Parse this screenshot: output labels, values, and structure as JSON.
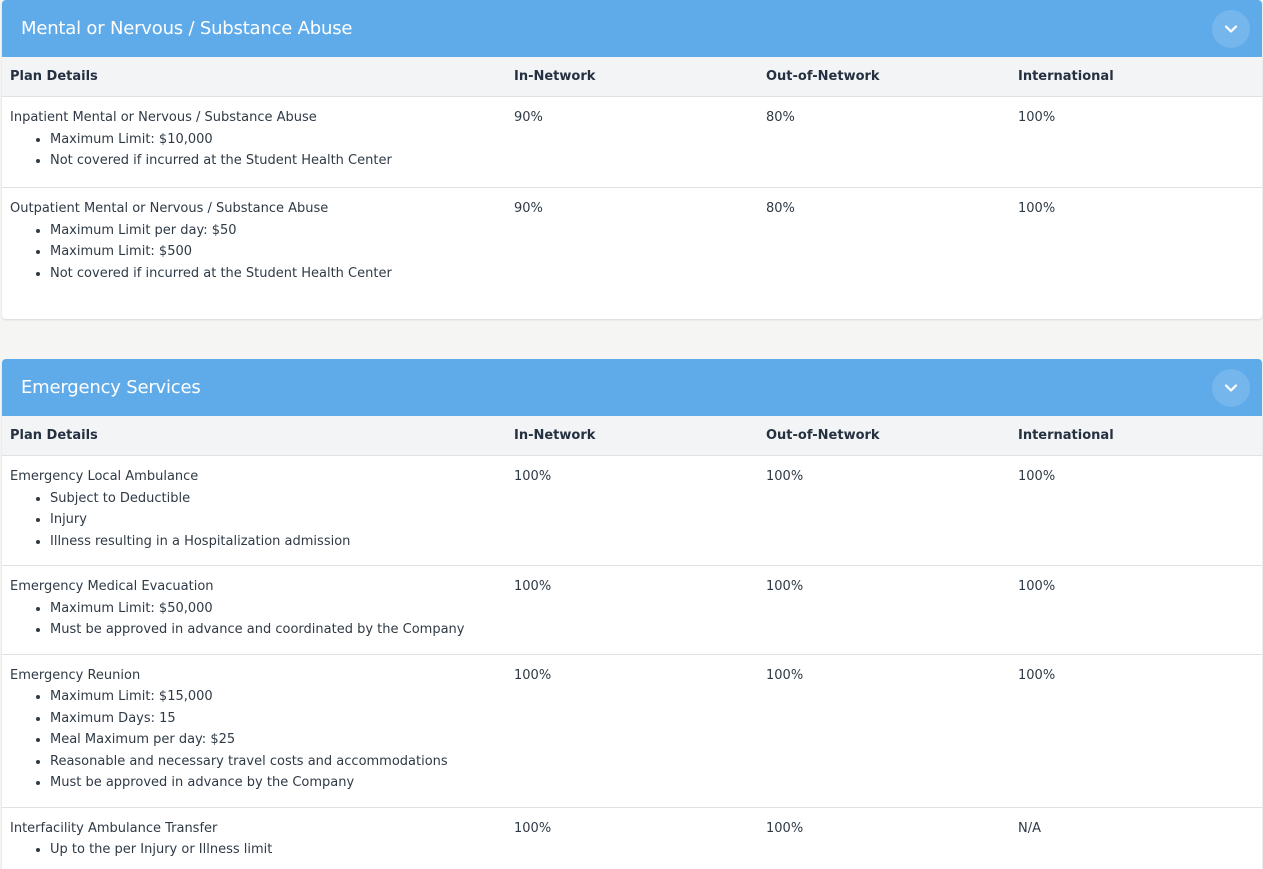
{
  "sections": [
    {
      "title": "Mental or Nervous / Substance Abuse",
      "headers": {
        "plan": "Plan Details",
        "in_network": "In-Network",
        "out_network": "Out-of-Network",
        "international": "International"
      },
      "rows": [
        {
          "name": "Inpatient Mental or Nervous / Substance Abuse",
          "details": [
            "Maximum Limit: $10,000",
            "Not covered if incurred at the Student Health Center"
          ],
          "in_network": "90%",
          "out_network": "80%",
          "international": "100%"
        },
        {
          "name": "Outpatient Mental or Nervous / Substance Abuse",
          "details": [
            "Maximum Limit per day: $50",
            "Maximum Limit: $500",
            "Not covered if incurred at the Student Health Center"
          ],
          "in_network": "90%",
          "out_network": "80%",
          "international": "100%"
        }
      ]
    },
    {
      "title": "Emergency Services",
      "headers": {
        "plan": "Plan Details",
        "in_network": "In-Network",
        "out_network": "Out-of-Network",
        "international": "International"
      },
      "rows": [
        {
          "name": "Emergency Local Ambulance",
          "details": [
            "Subject to Deductible",
            "Injury",
            "Illness resulting in a Hospitalization admission"
          ],
          "in_network": "100%",
          "out_network": "100%",
          "international": "100%"
        },
        {
          "name": "Emergency Medical Evacuation",
          "details": [
            "Maximum Limit: $50,000",
            "Must be approved in advance and coordinated by the Company"
          ],
          "in_network": "100%",
          "out_network": "100%",
          "international": "100%"
        },
        {
          "name": "Emergency Reunion",
          "details": [
            "Maximum Limit: $15,000",
            "Maximum Days: 15",
            "Meal Maximum per day: $25",
            "Reasonable and necessary travel costs and accommodations",
            "Must be approved in advance by the Company"
          ],
          "in_network": "100%",
          "out_network": "100%",
          "international": "100%"
        },
        {
          "name": "Interfacility Ambulance Transfer",
          "details": [
            "Up to the per Injury or Illness limit"
          ],
          "in_network": "100%",
          "out_network": "100%",
          "international": "N/A"
        }
      ]
    }
  ],
  "icons": {
    "collapse": "chevron-down-icon"
  },
  "colors": {
    "header_bg": "#5fabea",
    "header_text": "#ffffff",
    "table_head_bg": "#f2f4f6",
    "page_bg": "#f5f5f3"
  }
}
